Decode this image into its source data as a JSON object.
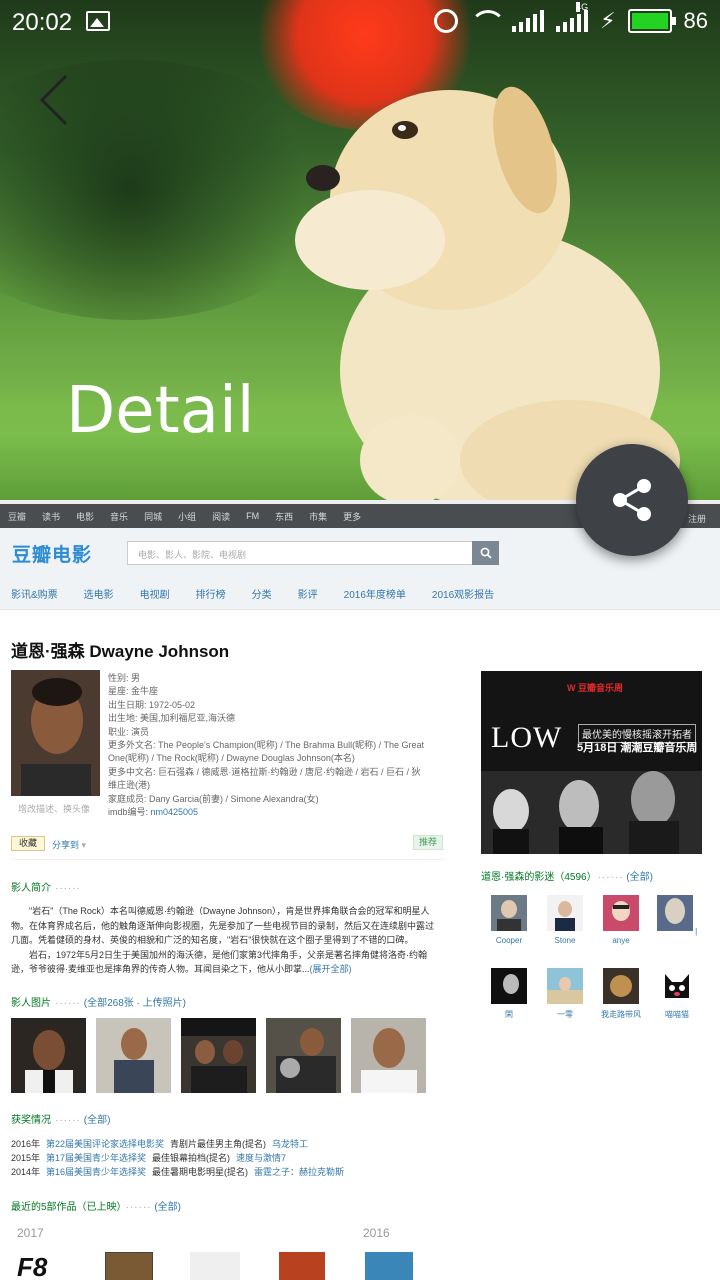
{
  "status_bar": {
    "time": "20:02",
    "network_type": "4G",
    "battery_level": "86",
    "icons": [
      "image-icon",
      "alarm-icon",
      "wifi-icon",
      "signal-icon",
      "charging-icon",
      "battery-icon"
    ]
  },
  "hero": {
    "title": "Detail",
    "back_icon": "chevron-left-icon",
    "share_icon": "share-icon"
  },
  "douban": {
    "global_nav": [
      "豆瓣",
      "读书",
      "电影",
      "音乐",
      "同城",
      "小组",
      "阅读",
      "FM",
      "东西",
      "市集",
      "更多"
    ],
    "global_nav_right": [
      "下载",
      "注册"
    ],
    "logo": "豆瓣电影",
    "search_placeholder": "电影、影人、影院、电视剧",
    "sub_nav": [
      "影讯&购票",
      "选电影",
      "电视剧",
      "排行榜",
      "分类",
      "影评",
      "2016年度榜单",
      "2016观影报告"
    ],
    "person": {
      "name": "道恩·强森 Dwayne Johnson",
      "avatar_hint": "增改描述、换头像",
      "info": [
        {
          "label": "性别: ",
          "value": "男"
        },
        {
          "label": "星座: ",
          "value": "金牛座"
        },
        {
          "label": "出生日期: ",
          "value": "1972-05-02"
        },
        {
          "label": "出生地: ",
          "value": "美国,加利福尼亚,海沃德"
        },
        {
          "label": "职业: ",
          "value": "演员"
        },
        {
          "label": "更多外文名: ",
          "value": "The People's Champion(昵称) / The Brahma Bull(昵称) / The Great One(昵称) / The Rock(昵称) / Dwayne Douglas Johnson(本名)"
        },
        {
          "label": "更多中文名: ",
          "value": "巨石强森 / 德威恩·道格拉斯·约翰逊 / 唐尼·约翰逊 / 岩石 / 巨石 / 狄维庄逊(港)"
        },
        {
          "label": "家庭成员: ",
          "value": "Dany Garcia(前妻) / Simone Alexandra(女)"
        }
      ],
      "imdb_label": "imdb编号: ",
      "imdb_id": "nm0425005",
      "collect": "收藏",
      "share_to": "分享到",
      "recommend": "推荐"
    },
    "intro": {
      "title": "影人简介",
      "dots": "······",
      "para1": "\"岩石\"（The Rock）本名叫德威恩·约翰逊（Dwayne Johnson），肯是世界摔角联合会的冠军和明星人物。在体育界成名后，他的触角逐渐伸向影视圈，先是参加了一些电视节目的录制，然后又在连续剧中露过几面。凭着健硕的身材、英俊的相貌和广泛的知名度，\"岩石\"很快就在这个圈子里得到了不错的口碑。",
      "para2": "岩石，1972年5月2日生于美国加州的海沃德，是他们家第3代摔角手，父亲是著名摔角健将洛奇·约翰逊，爷爷彼得·麦维亚也是摔角界的传奇人物。耳闻目染之下，他从小即掌...",
      "expand": "(展开全部)"
    },
    "photos": {
      "title": "影人图片",
      "dots": "······",
      "more": "(全部268张 · 上传照片)"
    },
    "awards": {
      "title": "获奖情况",
      "dots": "······",
      "more": "(全部)",
      "rows": [
        {
          "year": "2016年",
          "event": "第22届美国评论家选择电影奖",
          "category": "青剧片最佳男主角(提名)",
          "work": "乌龙特工"
        },
        {
          "year": "2015年",
          "event": "第17届美国青少年选择奖",
          "category": "最佳银幕拍档(提名)",
          "work": "速度与激情7"
        },
        {
          "year": "2014年",
          "event": "第16届美国青少年选择奖",
          "category": "最佳暑期电影明星(提名)",
          "work": "雷霆之子：赫拉克勒斯"
        }
      ]
    },
    "works": {
      "title": "最近的5部作品（已上映）",
      "dots": "······",
      "more": "(全部)",
      "years": [
        "2017",
        "2016"
      ],
      "f8_label": "F8"
    },
    "ad": {
      "brand": "W 豆瓣音乐周",
      "headline": "LOW",
      "tagline": "最优美的慢核摇滚开拓者",
      "date_line": "5月18日 潮潮豆瓣音乐周"
    },
    "fans": {
      "title": "道恩·强森的影迷（4596）",
      "dots": "······",
      "more": "(全部)",
      "names": [
        "Cooper",
        "Stone",
        "anye",
        "|",
        "閑",
        "一零",
        "我走路带风",
        "喵喵猫"
      ]
    }
  },
  "colors": {
    "douban_blue": "#3377aa",
    "douban_green": "#007722",
    "fab_bg": "#3e4246",
    "battery_green": "#22d322"
  }
}
